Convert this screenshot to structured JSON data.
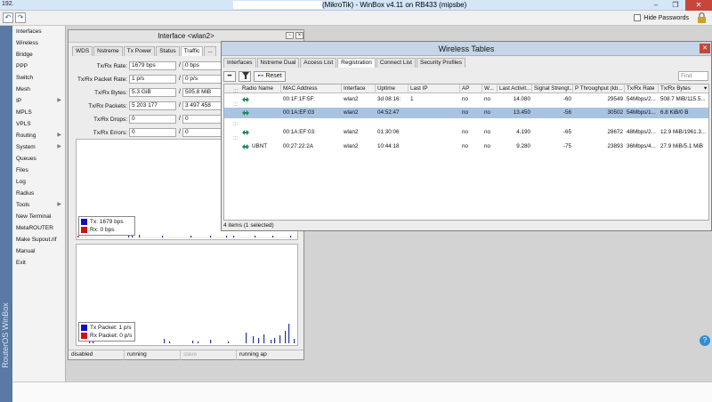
{
  "titlebar": {
    "address": "192.",
    "title": "(MikroTik) - WinBox v4.11 on RB433 (mipsbe)"
  },
  "toolbar": {
    "hide_passwords_label": "Hide Passwords"
  },
  "brand": "RouterOS WinBox",
  "sidemenu": [
    {
      "label": "Interfaces",
      "arrow": ""
    },
    {
      "label": "Wireless",
      "arrow": ""
    },
    {
      "label": "Bridge",
      "arrow": ""
    },
    {
      "label": "PPP",
      "arrow": ""
    },
    {
      "label": "Switch",
      "arrow": ""
    },
    {
      "label": "Mesh",
      "arrow": ""
    },
    {
      "label": "IP",
      "arrow": "▶"
    },
    {
      "label": "MPLS",
      "arrow": ""
    },
    {
      "label": "VPLS",
      "arrow": ""
    },
    {
      "label": "Routing",
      "arrow": "▶"
    },
    {
      "label": "System",
      "arrow": "▶"
    },
    {
      "label": "Queues",
      "arrow": ""
    },
    {
      "label": "Files",
      "arrow": ""
    },
    {
      "label": "Log",
      "arrow": ""
    },
    {
      "label": "Radius",
      "arrow": ""
    },
    {
      "label": "Tools",
      "arrow": "▶"
    },
    {
      "label": "New Terminal",
      "arrow": ""
    },
    {
      "label": "MetaROUTER",
      "arrow": ""
    },
    {
      "label": "Make Supout.rif",
      "arrow": ""
    },
    {
      "label": "Manual",
      "arrow": ""
    },
    {
      "label": "Exit",
      "arrow": ""
    }
  ],
  "interface_window": {
    "title": "Interface <wlan2>",
    "tabs": [
      "WDS",
      "Nstreme",
      "Tx Power",
      "Status",
      "Traffic",
      "..."
    ],
    "stats": [
      {
        "label": "Tx/Rx Rate:",
        "tx": "1679 bps",
        "rx": "0 bps"
      },
      {
        "label": "Tx/Rx Packet Rate:",
        "tx": "1 p/s",
        "rx": "0 p/s"
      },
      {
        "label": "Tx/Rx Bytes:",
        "tx": "5.3 GiB",
        "rx": "505.8 MiB"
      },
      {
        "label": "Tx/Rx Packets:",
        "tx": "5 203 177",
        "rx": "3 497 458"
      },
      {
        "label": "Tx/Rx Drops:",
        "tx": "0",
        "rx": "0"
      },
      {
        "label": "Tx/Rx Errors:",
        "tx": "0",
        "rx": "0"
      }
    ],
    "traffic_legend": {
      "tx": "Tx:   1679 bps",
      "rx": "Rx:   0 bps"
    },
    "packet_legend": {
      "tx": "Tx Packet:   1 p/s",
      "rx": "Rx Packet:   0 p/s"
    },
    "statusbar": [
      "disabled",
      "running",
      "slave",
      "running ap"
    ],
    "colors": {
      "tx": "#1010c0",
      "rx": "#d01010"
    }
  },
  "wireless_window": {
    "title": "Wireless Tables",
    "tabs": [
      "Interfaces",
      "Nstreme Dual",
      "Access List",
      "Registration",
      "Connect List",
      "Security Profiles"
    ],
    "active_tab": "Registration",
    "reset_label": "Reset",
    "find_placeholder": "Find",
    "columns": [
      "Radio Name",
      "MAC Address",
      "Interface",
      "Uptime",
      "Last IP",
      "AP",
      "W...",
      "Last Activit...",
      "Signal Strengt...",
      "P Throughput (kb...",
      "Tx/Rx Rate",
      "Tx/Rx Bytes"
    ],
    "rows": [
      {
        "radio_name": "",
        "mac": "00:1F:1F:5F:",
        "iface": "wlan2",
        "uptime": "3d 08:16:",
        "last_ip": "1",
        "ap": "no",
        "w": "no",
        "last_act": "14.080",
        "signal": "-60",
        "throughput": "29549",
        "rate": "54Mbps/2...",
        "bytes": "508.7 MiB/115.5..."
      },
      {
        "radio_name": "",
        "mac": "00:1A:EF:03",
        "iface": "wlan2",
        "uptime": "04:52:47",
        "last_ip": "",
        "ap": "no",
        "w": "no",
        "last_act": "13.450",
        "signal": "-56",
        "throughput": "30502",
        "rate": "54Mbps/1...",
        "bytes": "6.8 KiB/0 B"
      },
      {
        "radio_name": "",
        "mac": "00:1A:EF:03:",
        "iface": "wlan2",
        "uptime": "01:30:06",
        "last_ip": "",
        "ap": "no",
        "w": "no",
        "last_act": "4.190",
        "signal": "-65",
        "throughput": "28672",
        "rate": "48Mbps/2...",
        "bytes": "12.9 MiB/1961.3..."
      },
      {
        "radio_name": "UBNT",
        "mac": "00:27:22:2A",
        "iface": "wlan2",
        "uptime": "10:44:18",
        "last_ip": "",
        "ap": "no",
        "w": "no",
        "last_act": "9.280",
        "signal": "-75",
        "throughput": "23893",
        "rate": "36Mbps/4...",
        "bytes": "27.9 MiB/5.1 MiB"
      }
    ],
    "selected_row": 1,
    "status": "4 items (1 selected)"
  }
}
